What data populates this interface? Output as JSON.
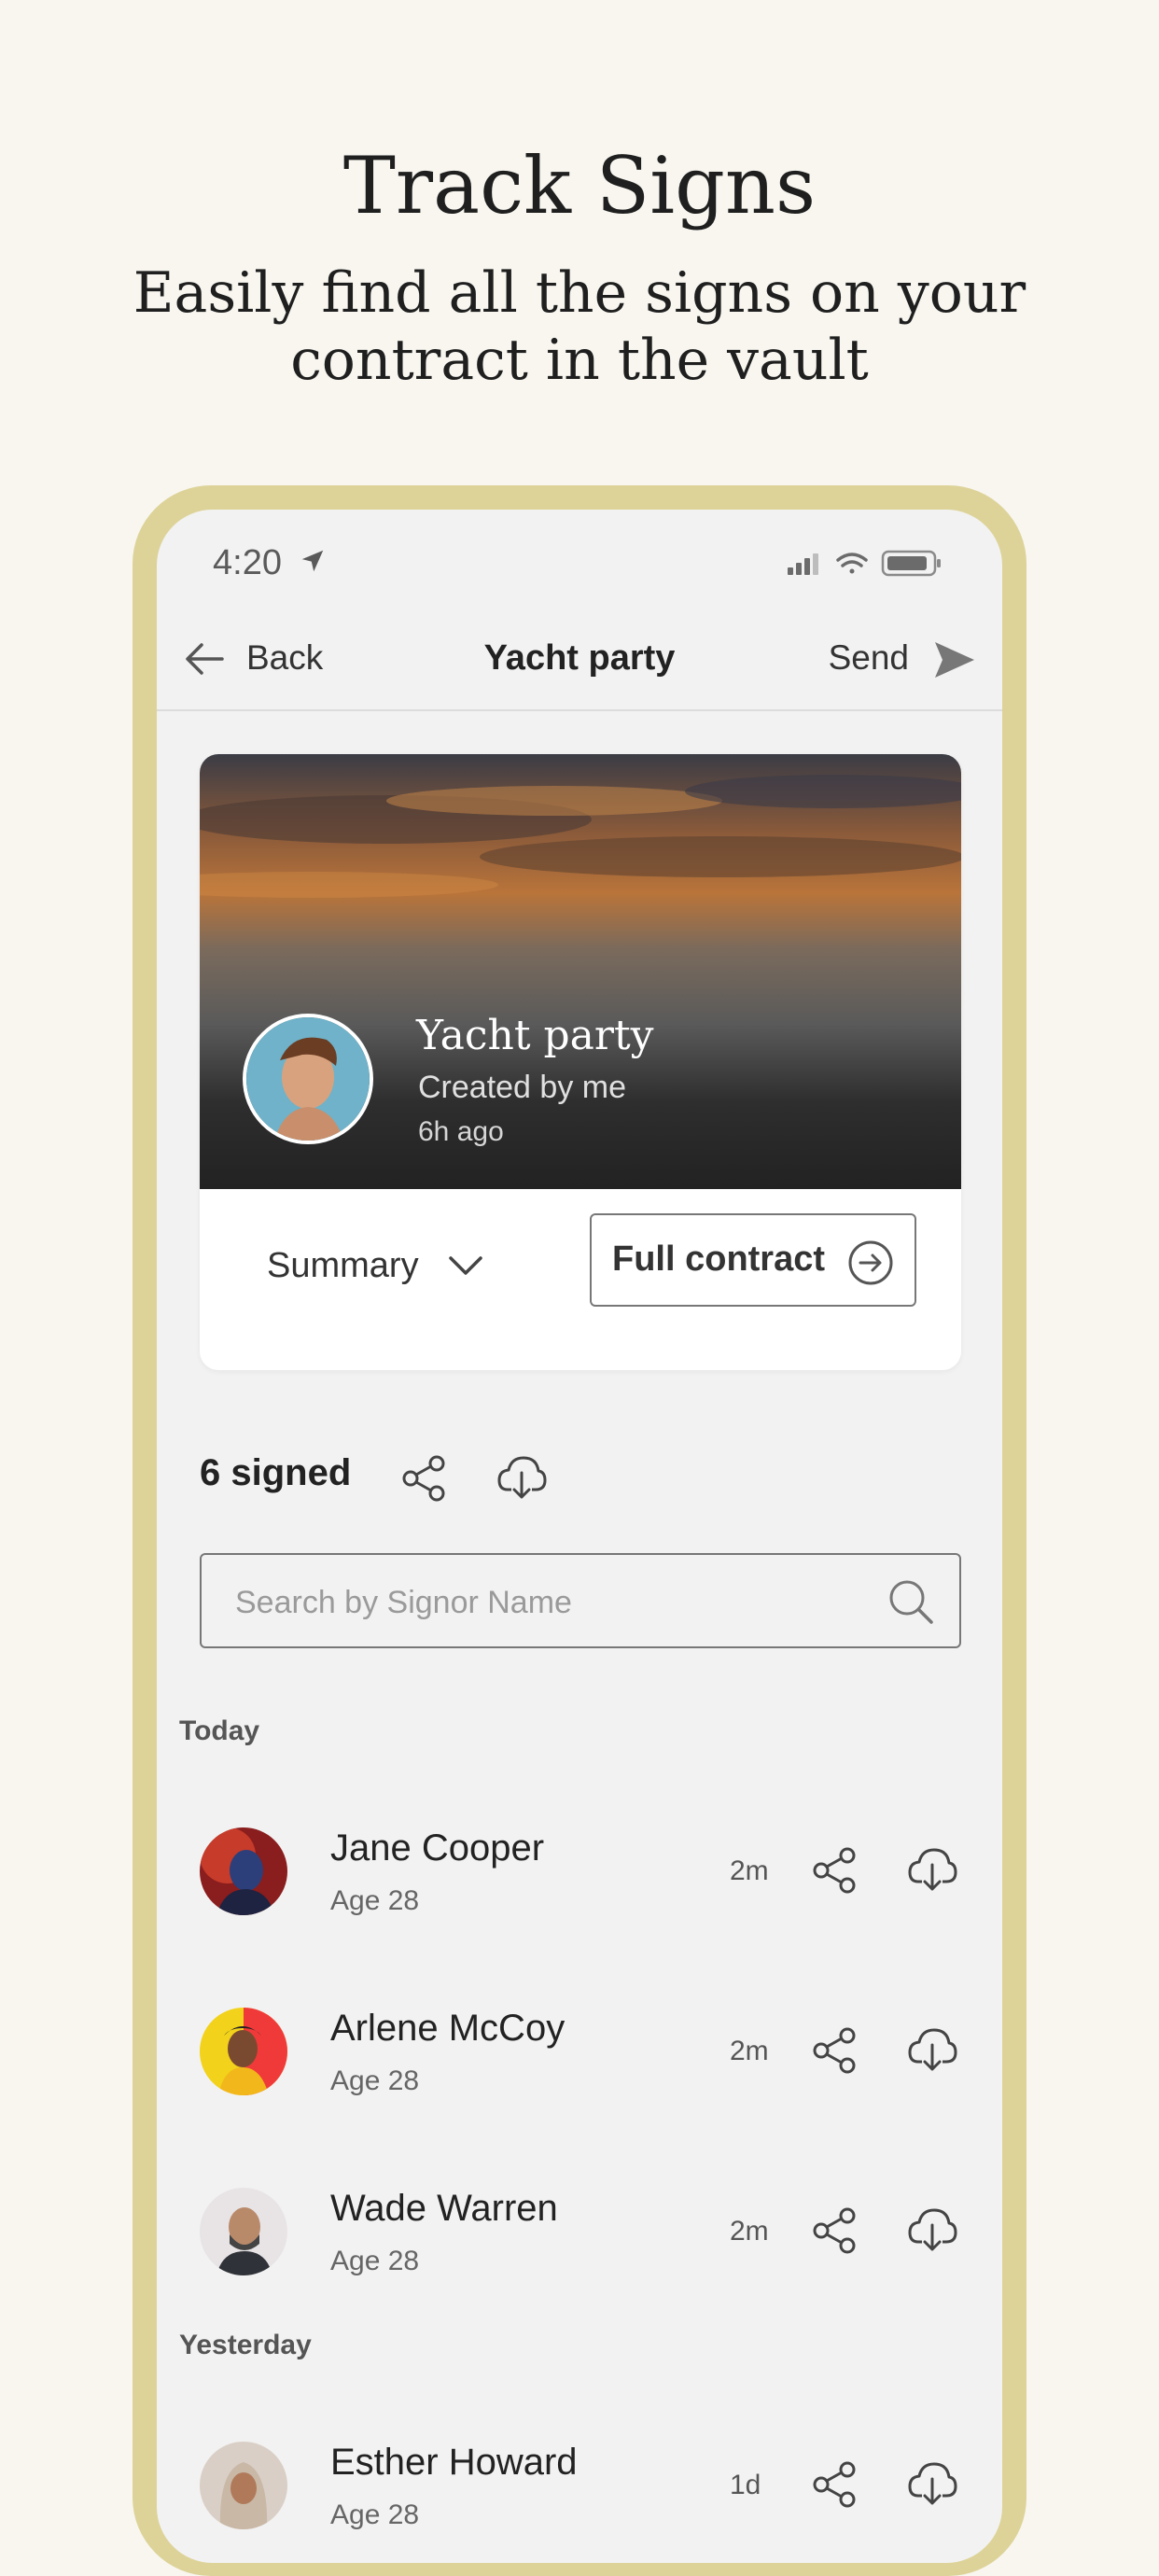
{
  "promo": {
    "title": "Track Signs",
    "subtitle_line1": "Easily find all the signs on your",
    "subtitle_line2": "contract in the vault"
  },
  "status_bar": {
    "time": "4:20"
  },
  "nav": {
    "back_label": "Back",
    "title": "Yacht party",
    "send_label": "Send"
  },
  "card": {
    "title": "Yacht party",
    "created_by": "Created by me",
    "time_ago": "6h ago",
    "summary_label": "Summary",
    "full_contract_label": "Full contract"
  },
  "signed": {
    "count_label": "6 signed"
  },
  "search": {
    "placeholder": "Search by Signor Name"
  },
  "sections": [
    {
      "label": "Today",
      "rows": [
        {
          "name": "Jane Cooper",
          "age": "Age 28",
          "time": "2m"
        },
        {
          "name": "Arlene McCoy",
          "age": "Age 28",
          "time": "2m"
        },
        {
          "name": "Wade Warren",
          "age": "Age 28",
          "time": "2m"
        }
      ]
    },
    {
      "label": "Yesterday",
      "rows": [
        {
          "name": "Esther Howard",
          "age": "Age 28",
          "time": "1d"
        }
      ]
    }
  ],
  "colors": {
    "page_bg": "#f8f6ef",
    "frame": "#ddd399",
    "screen_bg": "#f2f2f2",
    "card_bg": "#ffffff"
  },
  "icons": [
    "location-arrow-icon",
    "signal-icon",
    "wifi-icon",
    "battery-icon",
    "back-arrow-icon",
    "send-icon",
    "chevron-down-icon",
    "arrow-circle-icon",
    "share-icon",
    "cloud-download-icon",
    "search-icon"
  ]
}
